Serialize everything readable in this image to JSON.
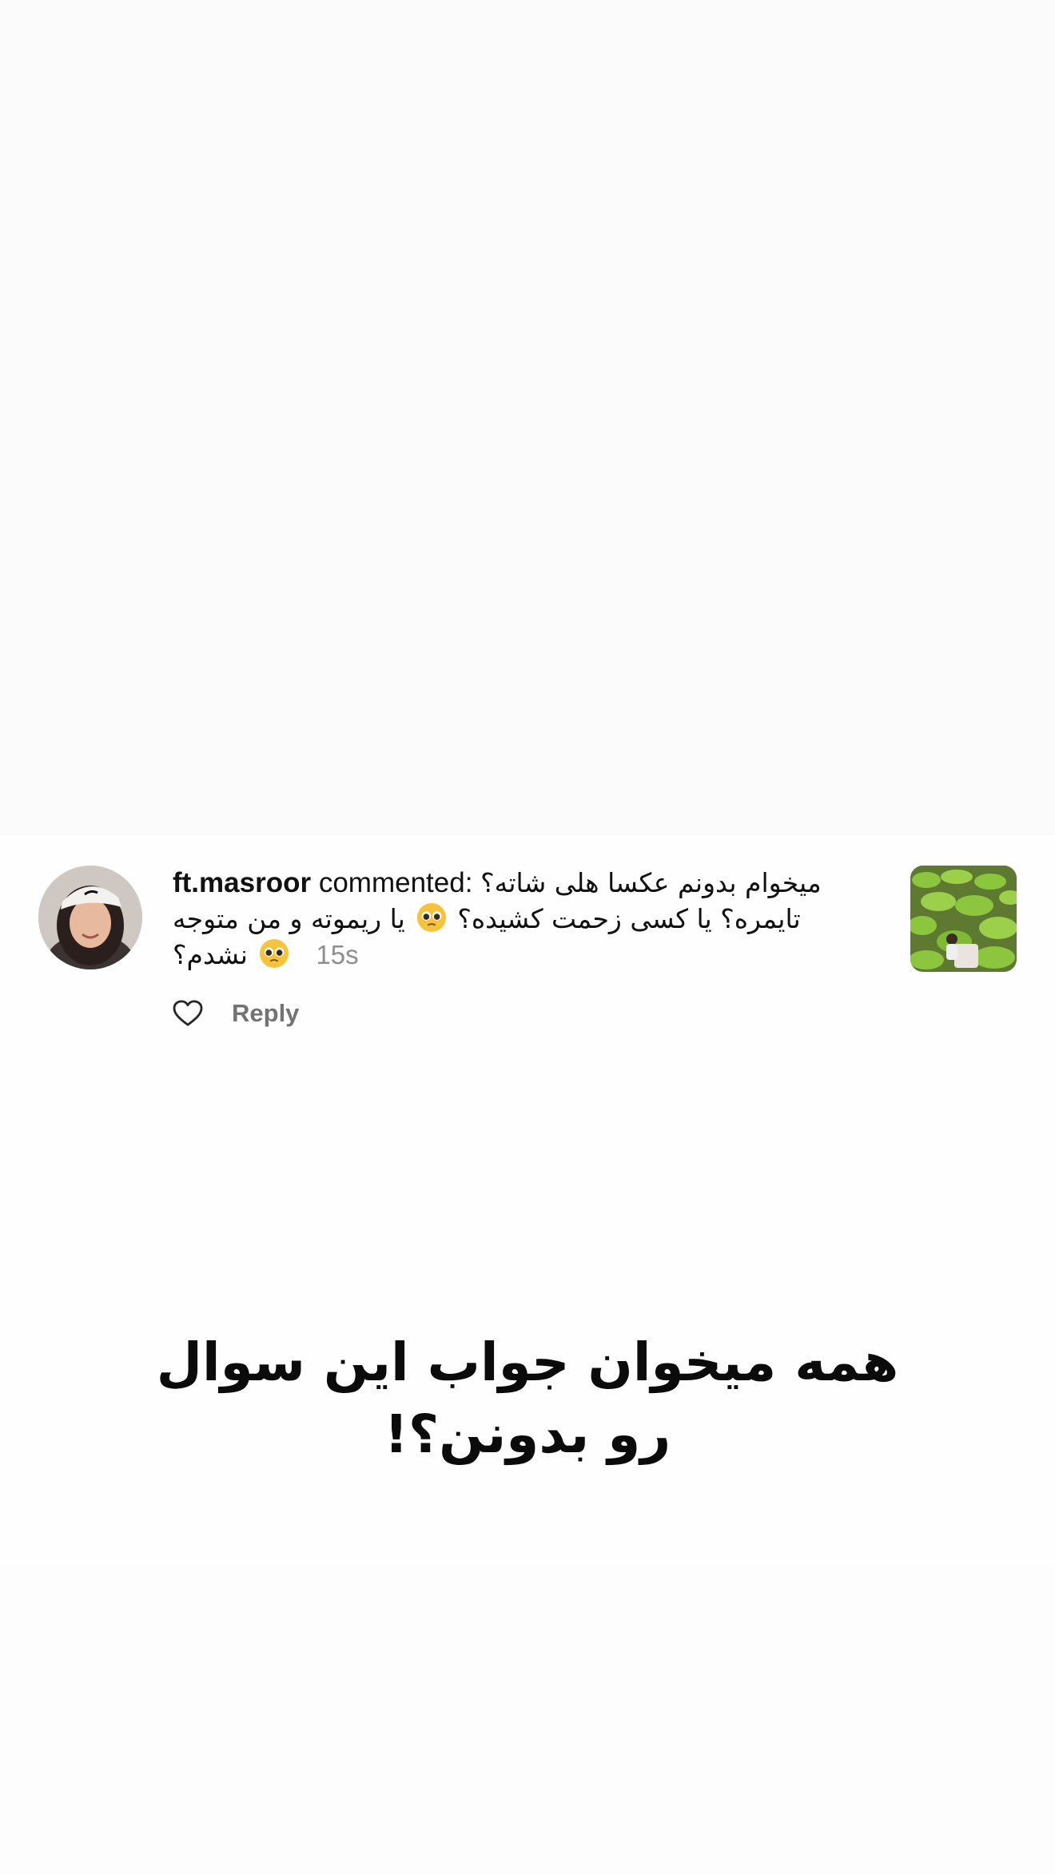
{
  "comment": {
    "username": "ft.masroor",
    "action": "commented:",
    "line1": "میخوام بدونم عکسا هلی شاته؟",
    "line2_a": "تایمره؟ یا کسی زحمت کشیده؟",
    "line2_b": "یا ریموته و من متوجه",
    "line3": "نشدم؟",
    "time": "15s",
    "reply_label": "Reply",
    "emoji_icon": "pleading-face-emoji"
  },
  "caption": {
    "line1": "همه میخوان جواب این سوال",
    "line2": "رو بدونن؟!"
  },
  "colors": {
    "username": "#111111",
    "timestamp": "#8e8e8e",
    "reply": "#737373",
    "caption": "#0b0b0b",
    "lilypad_green": "#8cc63f"
  }
}
